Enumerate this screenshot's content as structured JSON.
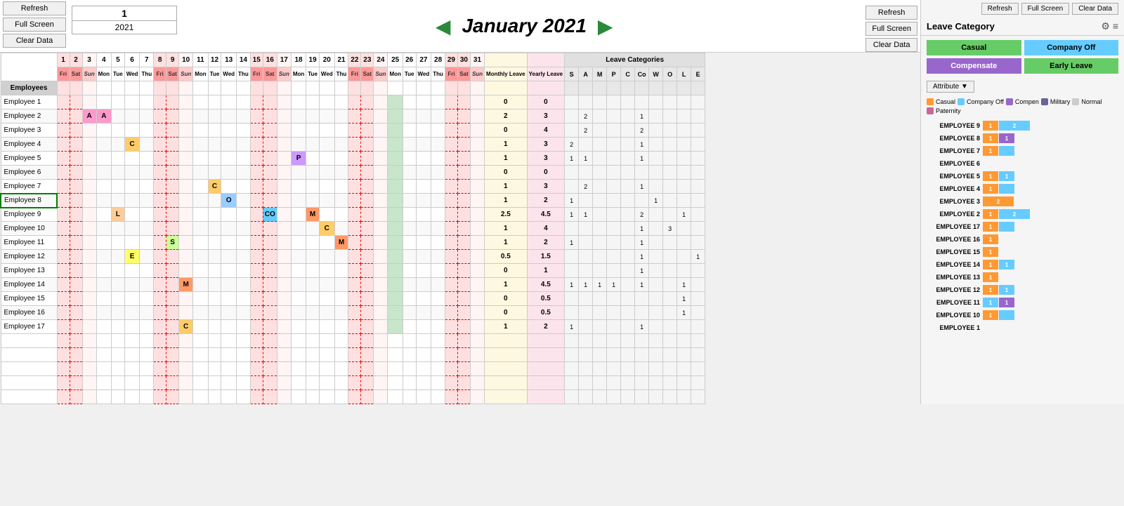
{
  "header": {
    "week": "1",
    "year": "2021",
    "month": "January 2021",
    "prev_arrow": "◀",
    "next_arrow": "▶"
  },
  "buttons": {
    "refresh": "Refresh",
    "full_screen": "Full Screen",
    "clear_data": "Clear Data"
  },
  "sidebar_buttons": {
    "refresh": "Refresh",
    "full_screen": "Full Screen",
    "clear_data": "Clear Data"
  },
  "calendar": {
    "days": [
      1,
      2,
      3,
      4,
      5,
      6,
      7,
      8,
      9,
      10,
      11,
      12,
      13,
      14,
      15,
      16,
      17,
      18,
      19,
      20,
      21,
      22,
      23,
      24,
      25,
      26,
      27,
      28,
      29,
      30,
      31
    ],
    "day_names": [
      "Fri",
      "Sat",
      "Sun",
      "Mon",
      "Tue",
      "Wed",
      "Thu",
      "Fri",
      "Sat",
      "Sun",
      "Mon",
      "Tue",
      "Wed",
      "Thu",
      "Fri",
      "Sat",
      "Sun",
      "Mon",
      "Tue",
      "Wed",
      "Thu",
      "Fri",
      "Sat",
      "Sun",
      "Mon",
      "Tue",
      "Wed",
      "Thu",
      "Fri",
      "Sat",
      "Sun"
    ],
    "employees_label": "Employees",
    "monthly_leave": "Monthly Leave",
    "yearly_leave": "Yearly Leave",
    "leave_categories": "Leave Categories",
    "lc_cols": [
      "S",
      "A",
      "M",
      "P",
      "C",
      "Co",
      "W",
      "O",
      "L",
      "E"
    ]
  },
  "employees": [
    {
      "name": "Employee 1",
      "leaves": {},
      "monthly": "0",
      "yearly": "0",
      "lc": {}
    },
    {
      "name": "Employee 2",
      "leaves": {
        "3": "A",
        "4": "A"
      },
      "monthly": "2",
      "yearly": "3",
      "lc": {
        "A": 2,
        "Co": 1
      }
    },
    {
      "name": "Employee 3",
      "leaves": {},
      "monthly": "0",
      "yearly": "4",
      "lc": {
        "A": 2,
        "Co": 2
      }
    },
    {
      "name": "Employee 4",
      "leaves": {
        "6": "C"
      },
      "monthly": "1",
      "yearly": "3",
      "lc": {
        "S": 2,
        "Co": 1
      }
    },
    {
      "name": "Employee 5",
      "leaves": {
        "18": "P"
      },
      "monthly": "1",
      "yearly": "3",
      "lc": {
        "S": 1,
        "A": 1,
        "Co": 1
      }
    },
    {
      "name": "Employee 6",
      "leaves": {},
      "monthly": "0",
      "yearly": "0",
      "lc": {}
    },
    {
      "name": "Employee 7",
      "leaves": {
        "12": "C"
      },
      "monthly": "1",
      "yearly": "3",
      "lc": {
        "A": 2,
        "Co": 1
      }
    },
    {
      "name": "Employee 8",
      "leaves": {
        "13": "O"
      },
      "monthly": "1",
      "yearly": "2",
      "lc": {
        "S": 1,
        "W": 1
      }
    },
    {
      "name": "Employee 9",
      "leaves": {
        "5": "L",
        "16": "CO",
        "19": "M"
      },
      "monthly": "2.5",
      "yearly": "4.5",
      "lc": {
        "S": 1,
        "A": 1,
        "Co": 2,
        "L": 1
      }
    },
    {
      "name": "Employee 10",
      "leaves": {
        "20": "C"
      },
      "monthly": "1",
      "yearly": "4",
      "lc": {
        "Co": 1,
        "O": 3
      }
    },
    {
      "name": "Employee 11",
      "leaves": {
        "9": "S",
        "21": "M"
      },
      "monthly": "1",
      "yearly": "2",
      "lc": {
        "S": 1,
        "Co": 1
      }
    },
    {
      "name": "Employee 12",
      "leaves": {
        "6": "E"
      },
      "monthly": "0.5",
      "yearly": "1.5",
      "lc": {
        "Co": 1,
        "E": 1
      }
    },
    {
      "name": "Employee 13",
      "leaves": {},
      "monthly": "0",
      "yearly": "1",
      "lc": {
        "Co": 1
      }
    },
    {
      "name": "Employee 14",
      "leaves": {
        "10": "M"
      },
      "monthly": "1",
      "yearly": "4.5",
      "lc": {
        "S": 1,
        "A": 1,
        "M": 1,
        "P": 1,
        "Co": 1,
        "L": 1
      }
    },
    {
      "name": "Employee 15",
      "leaves": {},
      "monthly": "0",
      "yearly": "0.5",
      "lc": {
        "L": 1
      }
    },
    {
      "name": "Employee 16",
      "leaves": {},
      "monthly": "0",
      "yearly": "0.5",
      "lc": {
        "L": 1
      }
    },
    {
      "name": "Employee 17",
      "leaves": {
        "10": "C"
      },
      "monthly": "1",
      "yearly": "2",
      "lc": {
        "S": 1,
        "Co": 1
      }
    }
  ],
  "right_panel": {
    "title": "Leave Category",
    "buttons": {
      "casual": "Casual",
      "company_off": "Company Off",
      "compensate": "Compensate",
      "early_leave": "Early Leave"
    },
    "top_buttons": {
      "refresh": "Refresh",
      "full_screen": "Full Screen",
      "clear_data": "Clear Data"
    },
    "attribute_label": "Attribute ▼",
    "legend": [
      {
        "label": "Casual",
        "color": "#ff9933"
      },
      {
        "label": "Company Off",
        "color": "#66ccff"
      },
      {
        "label": "Compen",
        "color": "#9966cc"
      },
      {
        "label": "Military",
        "color": "#666699"
      },
      {
        "label": "Normal",
        "color": "#cccccc"
      },
      {
        "label": "Paternity",
        "color": "#cc6699"
      }
    ],
    "chart_rows": [
      {
        "label": "EMPLOYEE 9",
        "bars": [
          {
            "type": "casual",
            "w": 1,
            "val": "1"
          },
          {
            "type": "companyoff",
            "w": 2,
            "val": "2"
          }
        ]
      },
      {
        "label": "EMPLOYEE 8",
        "bars": [
          {
            "type": "casual",
            "w": 1,
            "val": "1"
          },
          {
            "type": "compensate",
            "w": 1,
            "val": "1"
          }
        ]
      },
      {
        "label": "EMPLOYEE 7",
        "bars": [
          {
            "type": "casual",
            "w": 1,
            "val": "1"
          },
          {
            "type": "companyoff",
            "w": 1,
            "val": ""
          }
        ]
      },
      {
        "label": "EMPLOYEE 6",
        "bars": []
      },
      {
        "label": "EMPLOYEE 5",
        "bars": [
          {
            "type": "casual",
            "w": 1,
            "val": "1"
          },
          {
            "type": "companyoff",
            "w": 1,
            "val": "1"
          }
        ]
      },
      {
        "label": "EMPLOYEE 4",
        "bars": [
          {
            "type": "casual",
            "w": 1,
            "val": "1"
          },
          {
            "type": "companyoff",
            "w": 1,
            "val": ""
          }
        ]
      },
      {
        "label": "EMPLOYEE 3",
        "bars": [
          {
            "type": "casual",
            "w": 2,
            "val": "2"
          }
        ]
      },
      {
        "label": "EMPLOYEE 2",
        "bars": [
          {
            "type": "casual",
            "w": 1,
            "val": "1"
          },
          {
            "type": "companyoff",
            "w": 2,
            "val": "2"
          }
        ]
      },
      {
        "label": "EMPLOYEE 17",
        "bars": [
          {
            "type": "casual",
            "w": 1,
            "val": "1"
          },
          {
            "type": "companyoff",
            "w": 1,
            "val": ""
          }
        ]
      },
      {
        "label": "EMPLOYEE 16",
        "bars": [
          {
            "type": "casual",
            "w": 1,
            "val": "1"
          }
        ]
      },
      {
        "label": "EMPLOYEE 15",
        "bars": [
          {
            "type": "casual",
            "w": 1,
            "val": "1"
          }
        ]
      },
      {
        "label": "EMPLOYEE 14",
        "bars": [
          {
            "type": "casual",
            "w": 1,
            "val": "1"
          },
          {
            "type": "companyoff",
            "w": 1,
            "val": "1"
          }
        ]
      },
      {
        "label": "EMPLOYEE 13",
        "bars": [
          {
            "type": "casual",
            "w": 1,
            "val": "1"
          }
        ]
      },
      {
        "label": "EMPLOYEE 12",
        "bars": [
          {
            "type": "casual",
            "w": 1,
            "val": "1"
          },
          {
            "type": "companyoff",
            "w": 1,
            "val": "1"
          }
        ]
      },
      {
        "label": "EMPLOYEE 11",
        "bars": [
          {
            "type": "companyoff",
            "w": 1,
            "val": "1"
          },
          {
            "type": "compensate",
            "w": 1,
            "val": "1"
          }
        ]
      },
      {
        "label": "EMPLOYEE 10",
        "bars": [
          {
            "type": "casual",
            "w": 1,
            "val": "1"
          },
          {
            "type": "companyoff",
            "w": 1,
            "val": ""
          }
        ]
      },
      {
        "label": "EMPLOYEE 1",
        "bars": []
      }
    ]
  }
}
